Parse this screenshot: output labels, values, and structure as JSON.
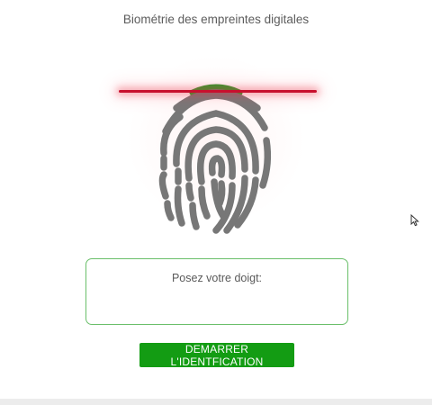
{
  "header": {
    "title": "Biométrie des empreintes digitales"
  },
  "scanner": {
    "fingerprint_icon": "fingerprint-icon",
    "scan_line_color": "#c8102e",
    "fingerprint_color": "#757575",
    "scan_progress_color": "#1f9a1f"
  },
  "prompt": {
    "label": "Posez votre doigt:",
    "border_color": "#6abf6a"
  },
  "actions": {
    "start_label": "DEMARRER L'IDENTFICATION",
    "start_color": "#139c13"
  }
}
